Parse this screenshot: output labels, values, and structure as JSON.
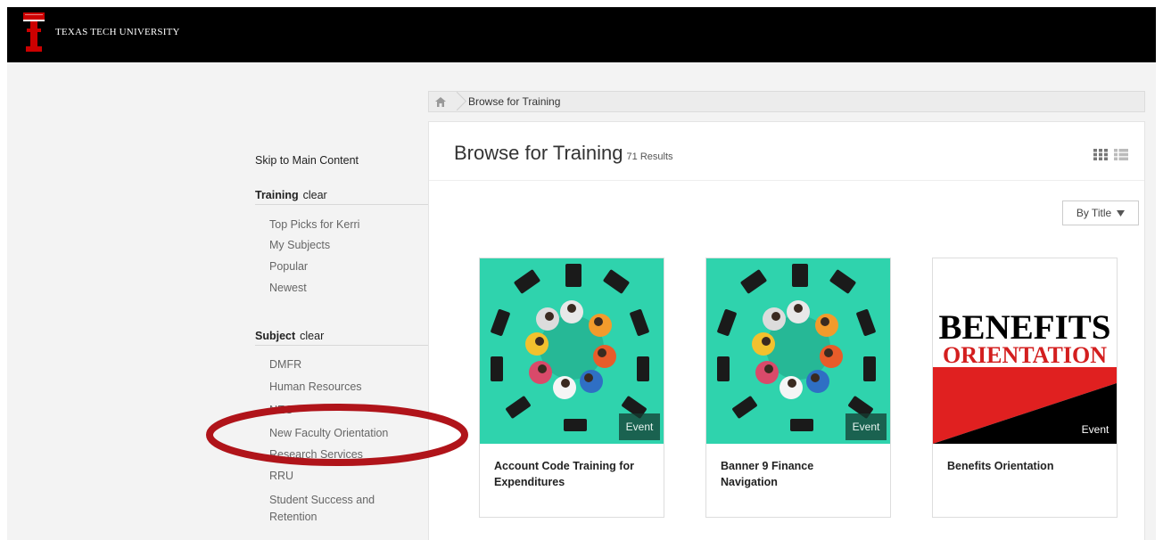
{
  "header": {
    "brand": "TEXAS TECH UNIVERSITY",
    "logo_icon": "double-t-logo-icon",
    "colors": {
      "bar": "#000000",
      "logo_red": "#cc0000"
    }
  },
  "breadcrumb": {
    "home_icon": "home-icon",
    "current": "Browse for Training"
  },
  "sidebar": {
    "skip_link": "Skip to Main Content",
    "training": {
      "title": "Training",
      "clear": "clear",
      "items": [
        "Top Picks for Kerri",
        "My Subjects",
        "Popular",
        "Newest"
      ]
    },
    "subject": {
      "title": "Subject",
      "clear": "clear",
      "items": [
        "DMFR",
        "Human Resources",
        "NEO",
        "New Faculty Orientation",
        "Research Services",
        "RRU",
        "Student Success and",
        "Retention"
      ]
    }
  },
  "main": {
    "title": "Browse for Training",
    "results": "71 Results",
    "view_icons": [
      "grid-view-icon",
      "list-view-icon"
    ],
    "sort": {
      "label": "By Title",
      "icon": "caret-down-icon"
    },
    "cards": [
      {
        "title_line1": "Account Code Training for",
        "title_line2": "Expenditures",
        "badge": "Event"
      },
      {
        "title_line1": "Banner 9 Finance",
        "title_line2": "Navigation",
        "badge": "Event"
      },
      {
        "title_line1": "Benefits Orientation",
        "title_line2": "",
        "badge": "Event",
        "banner_line1": "BENEFITS",
        "banner_line2": "ORIENTATION"
      }
    ]
  },
  "annotation": {
    "ellipse_color": "#b0141a"
  }
}
